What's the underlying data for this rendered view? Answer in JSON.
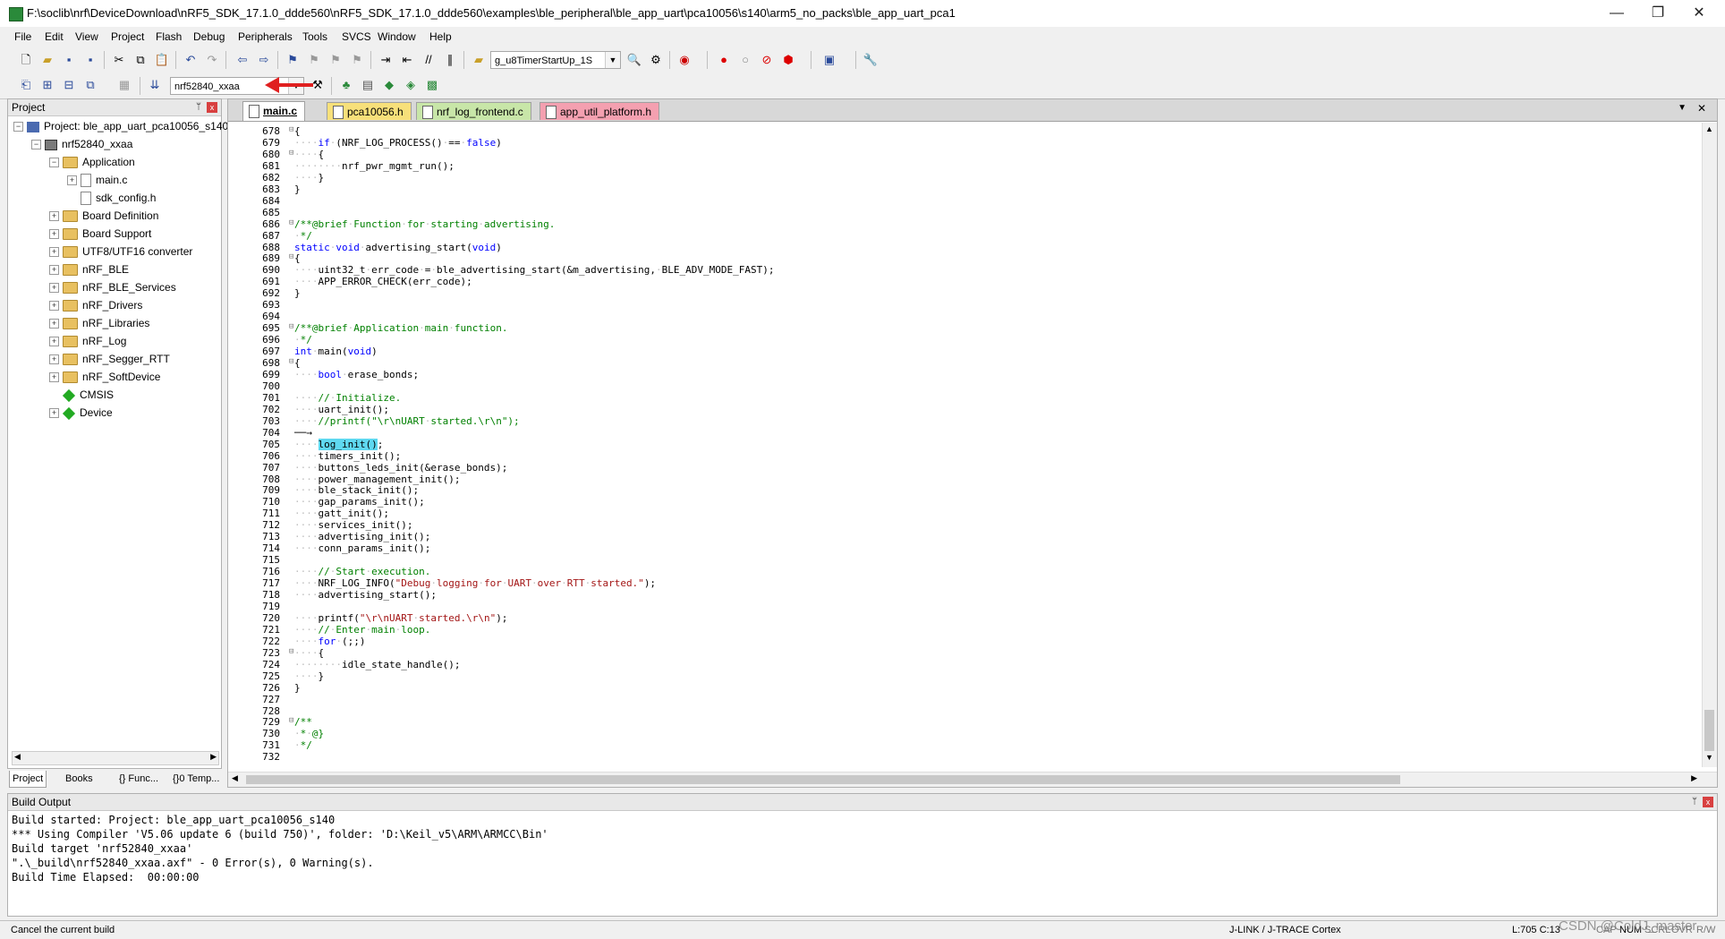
{
  "window": {
    "title": "F:\\soclib\\nrf\\DeviceDownload\\nRF5_SDK_17.1.0_ddde560\\nRF5_SDK_17.1.0_ddde560\\examples\\ble_peripheral\\ble_app_uart\\pca10056\\s140\\arm5_no_packs\\ble_app_uart_pca1",
    "minimize": "—",
    "maximize": "❐",
    "close": "✕"
  },
  "menu": [
    "File",
    "Edit",
    "View",
    "Project",
    "Flash",
    "Debug",
    "Peripherals",
    "Tools",
    "SVCS",
    "Window",
    "Help"
  ],
  "toolbar": {
    "find_combo": "g_u8TimerStartUp_1S",
    "target_combo": "nrf52840_xxaa"
  },
  "project_pane": {
    "header": "Project",
    "pin": "ᛘ",
    "close": "x",
    "tree": [
      {
        "label": "Project: ble_app_uart_pca10056_s140",
        "level": 0,
        "kind": "project",
        "exp": "⊟"
      },
      {
        "label": "nrf52840_xxaa",
        "level": 1,
        "kind": "target",
        "exp": "⊟"
      },
      {
        "label": "Application",
        "level": 2,
        "kind": "folder",
        "exp": "⊟"
      },
      {
        "label": "main.c",
        "level": 3,
        "kind": "file",
        "exp": "⊞"
      },
      {
        "label": "sdk_config.h",
        "level": 3,
        "kind": "file",
        "exp": ""
      },
      {
        "label": "Board Definition",
        "level": 2,
        "kind": "folder",
        "exp": "⊞"
      },
      {
        "label": "Board Support",
        "level": 2,
        "kind": "folder",
        "exp": "⊞"
      },
      {
        "label": "UTF8/UTF16 converter",
        "level": 2,
        "kind": "folder",
        "exp": "⊞"
      },
      {
        "label": "nRF_BLE",
        "level": 2,
        "kind": "folder",
        "exp": "⊞"
      },
      {
        "label": "nRF_BLE_Services",
        "level": 2,
        "kind": "folder",
        "exp": "⊞"
      },
      {
        "label": "nRF_Drivers",
        "level": 2,
        "kind": "folder",
        "exp": "⊞"
      },
      {
        "label": "nRF_Libraries",
        "level": 2,
        "kind": "folder",
        "exp": "⊞"
      },
      {
        "label": "nRF_Log",
        "level": 2,
        "kind": "folder",
        "exp": "⊞"
      },
      {
        "label": "nRF_Segger_RTT",
        "level": 2,
        "kind": "folder",
        "exp": "⊞"
      },
      {
        "label": "nRF_SoftDevice",
        "level": 2,
        "kind": "folder",
        "exp": "⊞"
      },
      {
        "label": "CMSIS",
        "level": 2,
        "kind": "component",
        "exp": ""
      },
      {
        "label": "Device",
        "level": 2,
        "kind": "component",
        "exp": "⊞"
      }
    ],
    "tabs": [
      "Project",
      "Books",
      "{} Func...",
      "{}0 Temp..."
    ]
  },
  "editor": {
    "tabs": [
      {
        "label": "main.c",
        "bg": "#ffffff",
        "active": true
      },
      {
        "label": "pca10056.h",
        "bg": "#f7e07a",
        "active": false
      },
      {
        "label": "nrf_log_frontend.c",
        "bg": "#c8e6a8",
        "active": false
      },
      {
        "label": "app_util_platform.h",
        "bg": "#f4a0b0",
        "active": false
      }
    ],
    "tab_menu": "▼",
    "tab_close": "✕",
    "lines": [
      {
        "n": "678",
        "f": "⊟",
        "c": "{"
      },
      {
        "n": "679",
        "f": "",
        "c": "····<kw>if</kw>·(NRF_LOG_PROCESS()·==·<kw>false</kw>)"
      },
      {
        "n": "680",
        "f": "⊟",
        "c": "····{"
      },
      {
        "n": "681",
        "f": "",
        "c": "········nrf_pwr_mgmt_run();"
      },
      {
        "n": "682",
        "f": "",
        "c": "····}"
      },
      {
        "n": "683",
        "f": "",
        "c": "}"
      },
      {
        "n": "684",
        "f": "",
        "c": ""
      },
      {
        "n": "685",
        "f": "",
        "c": ""
      },
      {
        "n": "686",
        "f": "⊟",
        "c": "<cm>/**@brief·Function·for·starting·advertising.</cm>"
      },
      {
        "n": "687",
        "f": "",
        "c": "<cm>·*/</cm>"
      },
      {
        "n": "688",
        "f": "",
        "c": "<kw>static</kw>·<kw>void</kw>·advertising_start(<kw>void</kw>)"
      },
      {
        "n": "689",
        "f": "⊟",
        "c": "{"
      },
      {
        "n": "690",
        "f": "",
        "c": "····uint32_t·err_code·=·ble_advertising_start(&m_advertising,·BLE_ADV_MODE_FAST);"
      },
      {
        "n": "691",
        "f": "",
        "c": "····APP_ERROR_CHECK(err_code);"
      },
      {
        "n": "692",
        "f": "",
        "c": "}"
      },
      {
        "n": "693",
        "f": "",
        "c": ""
      },
      {
        "n": "694",
        "f": "",
        "c": ""
      },
      {
        "n": "695",
        "f": "⊟",
        "c": "<cm>/**@brief·Application·main·function.</cm>"
      },
      {
        "n": "696",
        "f": "",
        "c": "<cm>·*/</cm>"
      },
      {
        "n": "697",
        "f": "",
        "c": "<kw>int</kw>·main(<kw>void</kw>)"
      },
      {
        "n": "698",
        "f": "⊟",
        "c": "{"
      },
      {
        "n": "699",
        "f": "",
        "c": "····<kw>bool</kw>·erase_bonds;"
      },
      {
        "n": "700",
        "f": "",
        "c": ""
      },
      {
        "n": "701",
        "f": "",
        "c": "····<cm>//·Initialize.</cm>"
      },
      {
        "n": "702",
        "f": "",
        "c": "····uart_init();"
      },
      {
        "n": "703",
        "f": "",
        "c": "····<cm>//printf(\"\\r\\nUART·started.\\r\\n\");</cm>"
      },
      {
        "n": "704",
        "f": "",
        "c": "──→"
      },
      {
        "n": "705",
        "f": "",
        "c": "····<hl>log_init()</hl>;"
      },
      {
        "n": "706",
        "f": "",
        "c": "····timers_init();"
      },
      {
        "n": "707",
        "f": "",
        "c": "····buttons_leds_init(&erase_bonds);"
      },
      {
        "n": "708",
        "f": "",
        "c": "····power_management_init();"
      },
      {
        "n": "709",
        "f": "",
        "c": "····ble_stack_init();"
      },
      {
        "n": "710",
        "f": "",
        "c": "····gap_params_init();"
      },
      {
        "n": "711",
        "f": "",
        "c": "····gatt_init();"
      },
      {
        "n": "712",
        "f": "",
        "c": "····services_init();"
      },
      {
        "n": "713",
        "f": "",
        "c": "····advertising_init();"
      },
      {
        "n": "714",
        "f": "",
        "c": "····conn_params_init();"
      },
      {
        "n": "715",
        "f": "",
        "c": ""
      },
      {
        "n": "716",
        "f": "",
        "c": "····<cm>//·Start·execution.</cm>"
      },
      {
        "n": "717",
        "f": "",
        "c": "····NRF_LOG_INFO(<str>\"Debug·logging·for·UART·over·RTT·started.\"</str>);"
      },
      {
        "n": "718",
        "f": "",
        "c": "····advertising_start();"
      },
      {
        "n": "719",
        "f": "",
        "c": ""
      },
      {
        "n": "720",
        "f": "",
        "c": "····printf(<str>\"\\r\\nUART·started.\\r\\n\"</str>);"
      },
      {
        "n": "721",
        "f": "",
        "c": "····<cm>//·Enter·main·loop.</cm>"
      },
      {
        "n": "722",
        "f": "",
        "c": "····<kw>for</kw>·(;;)"
      },
      {
        "n": "723",
        "f": "⊟",
        "c": "····{"
      },
      {
        "n": "724",
        "f": "",
        "c": "········idle_state_handle();"
      },
      {
        "n": "725",
        "f": "",
        "c": "····}"
      },
      {
        "n": "726",
        "f": "",
        "c": "}"
      },
      {
        "n": "727",
        "f": "",
        "c": ""
      },
      {
        "n": "728",
        "f": "",
        "c": ""
      },
      {
        "n": "729",
        "f": "⊟",
        "c": "<cm>/**</cm>"
      },
      {
        "n": "730",
        "f": "",
        "c": "<cm>·*·@}</cm>"
      },
      {
        "n": "731",
        "f": "",
        "c": "<cm>·*/</cm>"
      },
      {
        "n": "732",
        "f": "",
        "c": ""
      }
    ]
  },
  "build_output": {
    "header": "Build Output",
    "lines": [
      "Build started: Project: ble_app_uart_pca10056_s140",
      "*** Using Compiler 'V5.06 update 6 (build 750)', folder: 'D:\\Keil_v5\\ARM\\ARMCC\\Bin'",
      "Build target 'nrf52840_xxaa'",
      "\".\\_build\\nrf52840_xxaa.axf\" - 0 Error(s), 0 Warning(s).",
      "Build Time Elapsed:  00:00:00"
    ]
  },
  "status": {
    "left": "Cancel the current build",
    "debugger": "J-LINK / J-TRACE Cortex",
    "position": "L:705 C:13",
    "caps": "CAP",
    "num": "NUM",
    "scrl": "SCRL",
    "ovr": "OVR",
    "rw": "R/W",
    "watermark": "CSDN @ColdJ_master"
  }
}
